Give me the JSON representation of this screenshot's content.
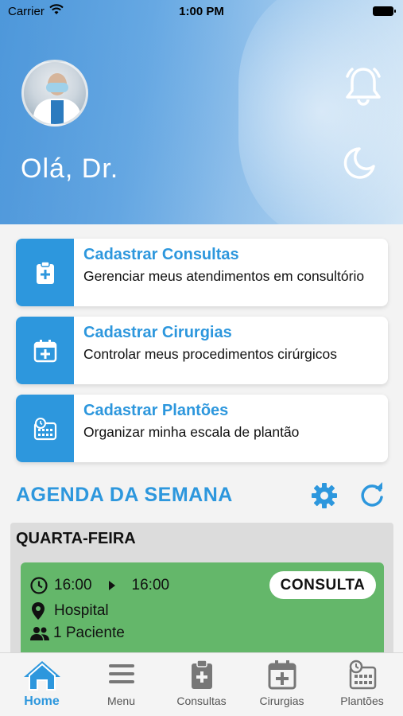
{
  "status_bar": {
    "carrier": "Carrier",
    "time": "1:00 PM"
  },
  "header": {
    "greeting": "Olá, Dr."
  },
  "cards": [
    {
      "title": "Cadastrar Consultas",
      "subtitle": "Gerenciar meus atendimentos em consultório",
      "icon": "clipboard-plus-icon"
    },
    {
      "title": "Cadastrar Cirurgias",
      "subtitle": "Controlar meus procedimentos cirúrgicos",
      "icon": "calendar-plus-icon"
    },
    {
      "title": "Cadastrar Plantões",
      "subtitle": "Organizar minha escala de plantão",
      "icon": "calendar-clock-icon"
    }
  ],
  "agenda": {
    "title": "AGENDA DA SEMANA",
    "day": "QUARTA-FEIRA",
    "appointment": {
      "start": "16:00",
      "end": "16:00",
      "type": "CONSULTA",
      "location": "Hospital",
      "patients": "1 Paciente",
      "color": "#64b76a"
    }
  },
  "tabs": [
    {
      "label": "Home",
      "icon": "home-icon",
      "active": true
    },
    {
      "label": "Menu",
      "icon": "menu-icon"
    },
    {
      "label": "Consultas",
      "icon": "clipboard-plus-icon"
    },
    {
      "label": "Cirurgias",
      "icon": "calendar-plus-icon"
    },
    {
      "label": "Plantões",
      "icon": "calendar-clock-icon"
    }
  ],
  "colors": {
    "accent": "#2d97dd",
    "appointment": "#64b76a"
  }
}
